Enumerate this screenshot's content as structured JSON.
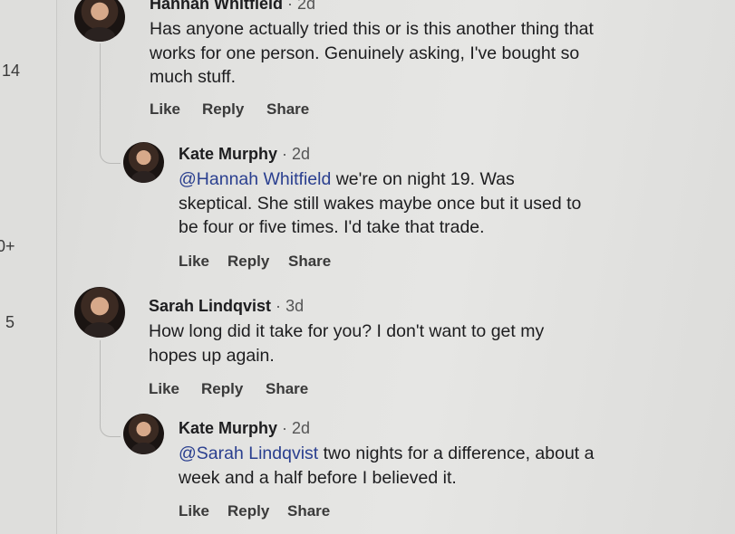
{
  "rail": {
    "numbers": [
      "14",
      "0+",
      "5"
    ]
  },
  "comments": [
    {
      "author": "Hannah Whitfield",
      "sep": "·",
      "time": "2d",
      "text": "Has anyone actually tried this or is this another thing that works for one person. Genuinely asking, I've bought so much stuff.",
      "actions": {
        "like": "Like",
        "reply": "Reply",
        "share": "Share"
      }
    },
    {
      "author": "Kate Murphy",
      "sep": "·",
      "time": "2d",
      "mention": "@Hannah Whitfield",
      "text": " we're on night 19. Was skeptical. She still wakes maybe once but it used to be four or five times. I'd take that trade.",
      "actions": {
        "like": "Like",
        "reply": "Reply",
        "share": "Share"
      }
    },
    {
      "author": "Sarah Lindqvist",
      "sep": "·",
      "time": "3d",
      "text": "How long did it take for you? I don't want to get my hopes up again.",
      "actions": {
        "like": "Like",
        "reply": "Reply",
        "share": "Share"
      }
    },
    {
      "author": "Kate Murphy",
      "sep": "·",
      "time": "2d",
      "mention": "@Sarah Lindqvist",
      "text": " two nights for a difference, about a week and a half before I believed it.",
      "actions": {
        "like": "Like",
        "reply": "Reply",
        "share": "Share"
      }
    }
  ]
}
